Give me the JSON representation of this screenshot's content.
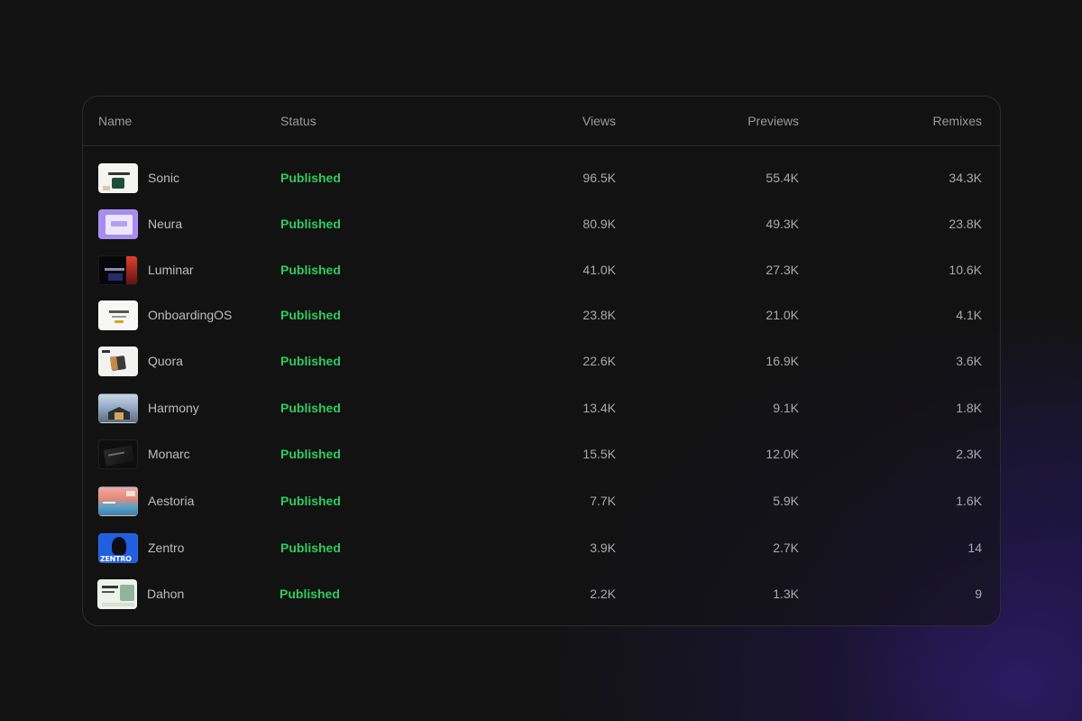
{
  "table": {
    "headers": {
      "name": "Name",
      "status": "Status",
      "views": "Views",
      "previews": "Previews",
      "remixes": "Remixes"
    },
    "rows": [
      {
        "name": "Sonic",
        "status": "Published",
        "views": "96.5K",
        "previews": "55.4K",
        "remixes": "34.3K",
        "thumb": "sonic-thumbnail"
      },
      {
        "name": "Neura",
        "status": "Published",
        "views": "80.9K",
        "previews": "49.3K",
        "remixes": "23.8K",
        "thumb": "neura-thumbnail"
      },
      {
        "name": "Luminar",
        "status": "Published",
        "views": "41.0K",
        "previews": "27.3K",
        "remixes": "10.6K",
        "thumb": "luminar-thumbnail"
      },
      {
        "name": "OnboardingOS",
        "status": "Published",
        "views": "23.8K",
        "previews": "21.0K",
        "remixes": "4.1K",
        "thumb": "onboardingos-thumbnail"
      },
      {
        "name": "Quora",
        "status": "Published",
        "views": "22.6K",
        "previews": "16.9K",
        "remixes": "3.6K",
        "thumb": "quora-thumbnail"
      },
      {
        "name": "Harmony",
        "status": "Published",
        "views": "13.4K",
        "previews": "9.1K",
        "remixes": "1.8K",
        "thumb": "harmony-thumbnail"
      },
      {
        "name": "Monarc",
        "status": "Published",
        "views": "15.5K",
        "previews": "12.0K",
        "remixes": "2.3K",
        "thumb": "monarc-thumbnail"
      },
      {
        "name": "Aestoria",
        "status": "Published",
        "views": "7.7K",
        "previews": "5.9K",
        "remixes": "1.6K",
        "thumb": "aestoria-thumbnail"
      },
      {
        "name": "Zentro",
        "status": "Published",
        "views": "3.9K",
        "previews": "2.7K",
        "remixes": "14",
        "thumb": "zentro-thumbnail",
        "thumb_text": "ZENTRO"
      },
      {
        "name": "Dahon",
        "status": "Published",
        "views": "2.2K",
        "previews": "1.3K",
        "remixes": "9",
        "thumb": "dahon-thumbnail"
      }
    ]
  },
  "colors": {
    "background": "#131313",
    "status_published": "#2ecc5e",
    "accent_glow": "#30207a"
  }
}
